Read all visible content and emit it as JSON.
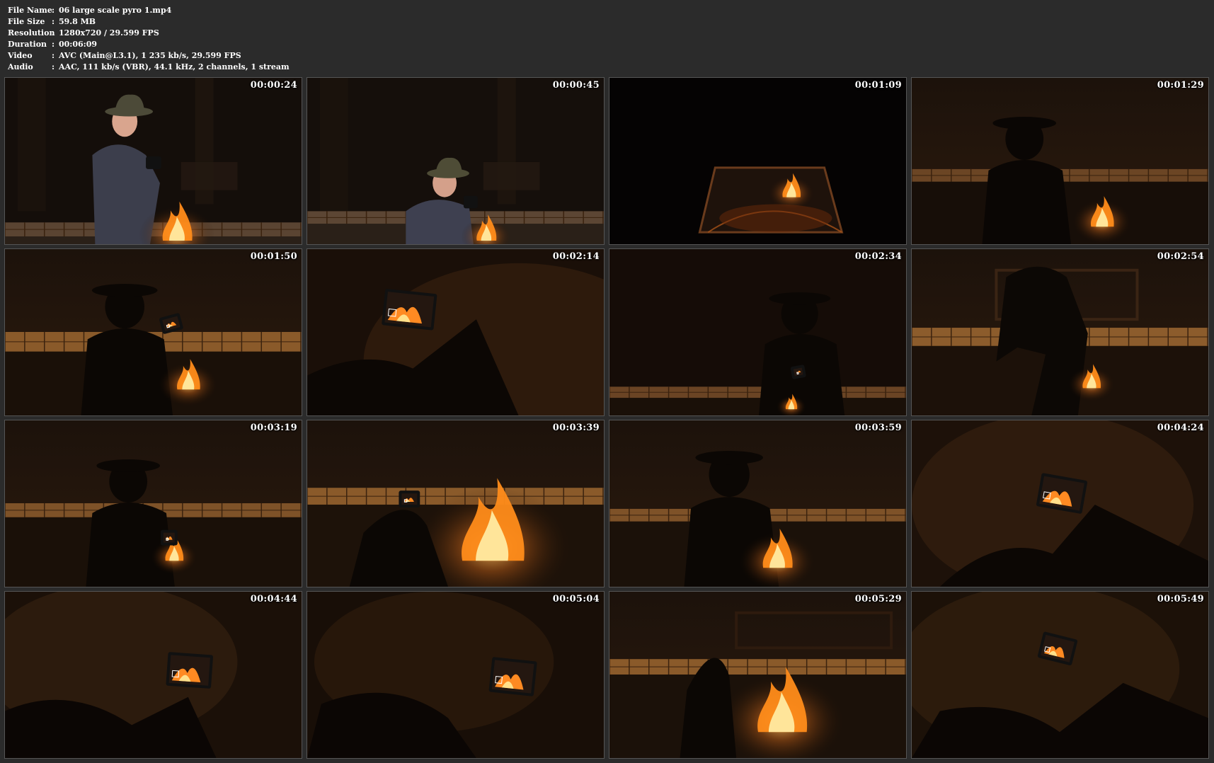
{
  "media_info": [
    {
      "label": "File Name",
      "value": "06 large scale pyro 1.mp4"
    },
    {
      "label": "File Size",
      "value": "59.8 MB"
    },
    {
      "label": "Resolution",
      "value": "1280x720 / 29.599 FPS"
    },
    {
      "label": "Duration",
      "value": "00:06:09"
    },
    {
      "label": "Video",
      "value": "AVC (Main@L3.1), 1 235 kb/s, 29.599 FPS"
    },
    {
      "label": "Audio",
      "value": "AAC, 111 kb/s (VBR), 44.1 kHz, 2 channels, 1 stream"
    }
  ],
  "separator": ":",
  "thumbnails": [
    {
      "timestamp": "00:00:24",
      "scene": "man-hat-camera-standing"
    },
    {
      "timestamp": "00:00:45",
      "scene": "man-hat-camera-crouch"
    },
    {
      "timestamp": "00:01:09",
      "scene": "dark-fire-pit-wide"
    },
    {
      "timestamp": "00:01:29",
      "scene": "silhouette-fire-pit"
    },
    {
      "timestamp": "00:01:50",
      "scene": "silhouette-camera-screen"
    },
    {
      "timestamp": "00:02:14",
      "scene": "camera-screen-closeup"
    },
    {
      "timestamp": "00:02:34",
      "scene": "silhouette-dark-wall"
    },
    {
      "timestamp": "00:02:54",
      "scene": "silhouette-walking"
    },
    {
      "timestamp": "00:03:19",
      "scene": "silhouette-crouch-fire"
    },
    {
      "timestamp": "00:03:39",
      "scene": "big-fire-camera"
    },
    {
      "timestamp": "00:03:59",
      "scene": "silhouette-reach-fire"
    },
    {
      "timestamp": "00:04:24",
      "scene": "camera-screen-closeup-2"
    },
    {
      "timestamp": "00:04:44",
      "scene": "camera-screen-closeup-3"
    },
    {
      "timestamp": "00:05:04",
      "scene": "camera-screen-closeup-4"
    },
    {
      "timestamp": "00:05:29",
      "scene": "fire-pit-silhouette"
    },
    {
      "timestamp": "00:05:49",
      "scene": "camera-screen-dark"
    }
  ],
  "colors": {
    "background": "#2b2b2b",
    "frame_dark": "#0c0806",
    "fire_orange": "#ff9a1e",
    "fire_yellow": "#ffe27a",
    "brick": "#8a5a2a"
  }
}
